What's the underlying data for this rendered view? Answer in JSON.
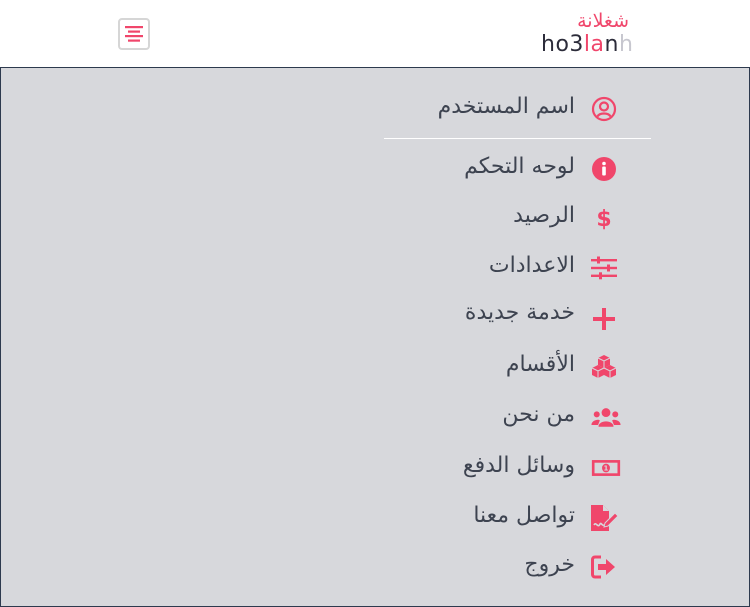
{
  "brand": {
    "name_ar": "شغلانة",
    "name_en_parts": [
      "ho",
      "3",
      "la",
      "n",
      "h"
    ]
  },
  "colors": {
    "accent": "#f0466b",
    "panel_bg": "#d7d8dc",
    "text": "#3d4350"
  },
  "menu": {
    "username": "اسم المستخدم",
    "items": [
      {
        "label": "لوحه التحكم",
        "icon": "info-circle-icon"
      },
      {
        "label": "الرصيد",
        "icon": "dollar-icon"
      },
      {
        "label": "الاعدادات",
        "icon": "sliders-icon"
      },
      {
        "label": "خدمة جديدة",
        "icon": "plus-icon"
      },
      {
        "label": "الأقسام",
        "icon": "cubes-icon"
      },
      {
        "label": "من نحن",
        "icon": "users-icon"
      },
      {
        "label": "وسائل الدفع",
        "icon": "money-bill-icon"
      },
      {
        "label": "تواصل معنا",
        "icon": "file-signature-icon"
      },
      {
        "label": "خروج",
        "icon": "sign-out-icon"
      }
    ]
  }
}
